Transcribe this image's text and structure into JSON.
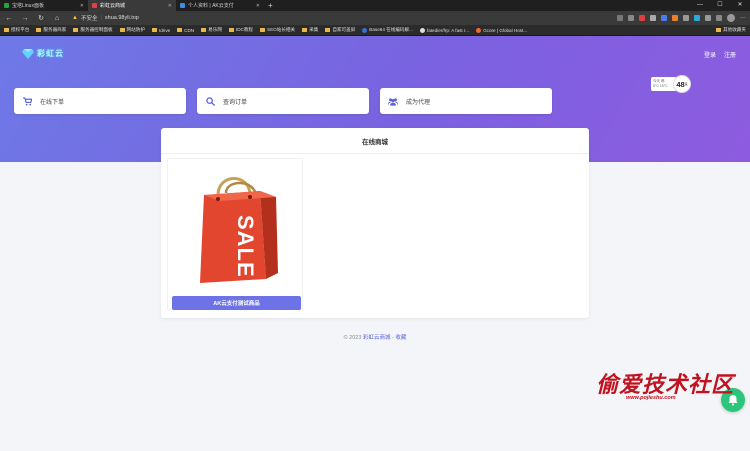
{
  "browser": {
    "tabs": [
      {
        "title": "宝塔Linux面板",
        "favicon_color": "#20a53a",
        "active": false
      },
      {
        "title": "彩虹云商城",
        "favicon_color": "#e04040",
        "active": true
      },
      {
        "title": "个人资料 | AK云支付",
        "favicon_color": "#3a8ee6",
        "active": false
      }
    ],
    "new_tab": "+",
    "security_label": "不安全",
    "url": "shua.98yli.top",
    "bookmarks": [
      "授权平台",
      "服务器商家",
      "服务器控制面板",
      "网站防护",
      "Idrive",
      "CDN",
      "易乐网",
      "IDC教程",
      "SEO站长相关",
      "采集",
      "自家可盖屏",
      "Base64 在线编码解...",
      "fatedier/frp: A fast r...",
      "Gcore | Global Host..."
    ],
    "bookmarks_right": "其他收藏夹"
  },
  "site": {
    "logo_text": "彩虹云",
    "login": "登录",
    "register": "注册",
    "weather": {
      "line1": "今天 晴",
      "line2": "5°C 15°C",
      "aqi": "48",
      "aqi_unit": "良"
    },
    "quick": [
      {
        "label": "在线下单",
        "icon": "cart-icon"
      },
      {
        "label": "查询订单",
        "icon": "search-icon"
      },
      {
        "label": "成为代理",
        "icon": "users-icon"
      }
    ],
    "mall_title": "在线商城",
    "product": {
      "name": "AK云支付测试商品",
      "image_text": "SALE"
    },
    "footer": {
      "copyright": "© 2023",
      "site": "彩虹云商城",
      "sep": "-",
      "link2": "收藏"
    }
  },
  "watermark": {
    "text": "偷爱技术社区",
    "url": "www.pojieshu.com"
  },
  "colors": {
    "hero_start": "#6e79e6",
    "hero_end": "#8e5bdf",
    "accent": "#6d73e6",
    "fab": "#2bc67a",
    "watermark": "#c1121f"
  }
}
